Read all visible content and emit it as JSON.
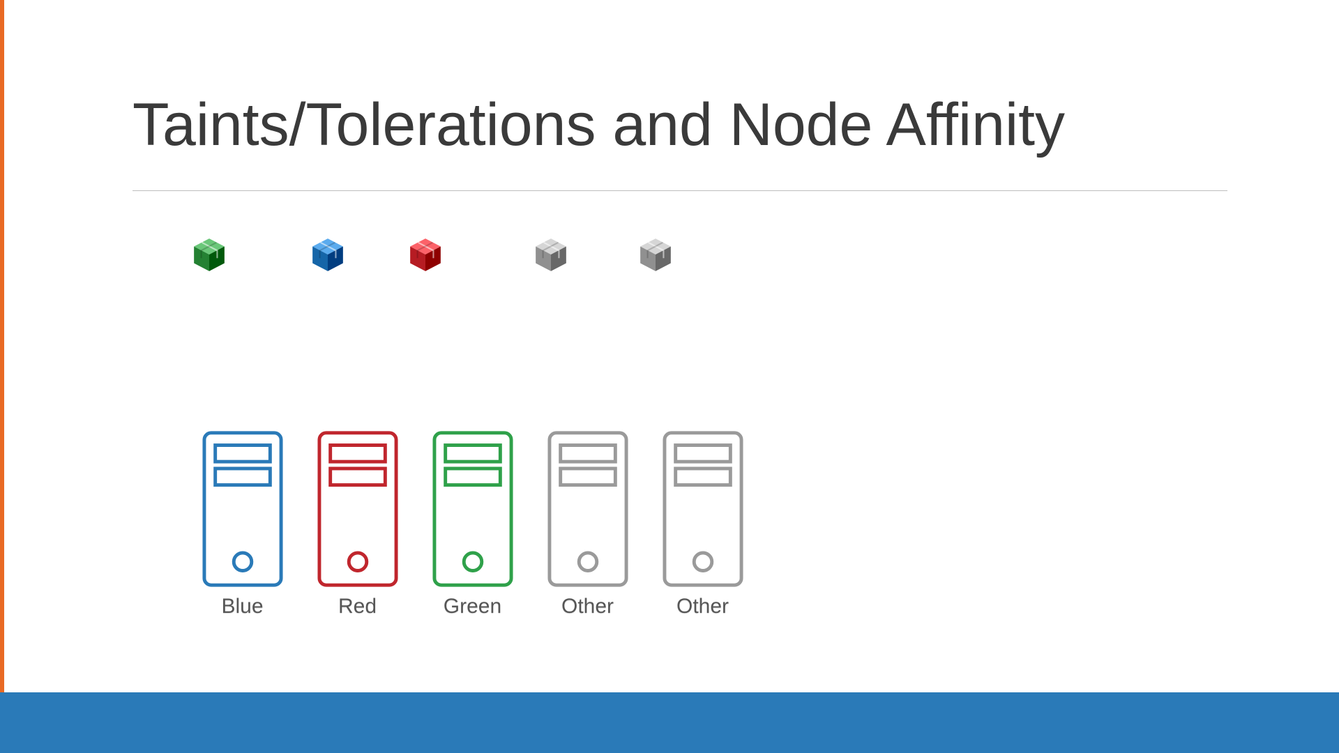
{
  "title": "Taints/Tolerations and Node Affinity",
  "pods": [
    {
      "name": "green-pod",
      "color": "#2e8b3d",
      "gap": 0
    },
    {
      "name": "blue-pod",
      "color": "#1f6fb2",
      "gap": 110
    },
    {
      "name": "red-pod",
      "color": "#c0262d",
      "gap": 80
    },
    {
      "name": "gray-pod-1",
      "color": "#9a9a9a",
      "gap": 120
    },
    {
      "name": "gray-pod-2",
      "color": "#9a9a9a",
      "gap": 90
    }
  ],
  "nodes": [
    {
      "name": "blue-node",
      "label": "Blue",
      "color": "#2a7ab8"
    },
    {
      "name": "red-node",
      "label": "Red",
      "color": "#c0262d"
    },
    {
      "name": "green-node",
      "label": "Green",
      "color": "#2fa14a"
    },
    {
      "name": "other-node-1",
      "label": "Other",
      "color": "#9a9a9a"
    },
    {
      "name": "other-node-2",
      "label": "Other",
      "color": "#9a9a9a"
    }
  ],
  "colors": {
    "footer": "#2a7ab8",
    "accent": "#e96a24"
  }
}
